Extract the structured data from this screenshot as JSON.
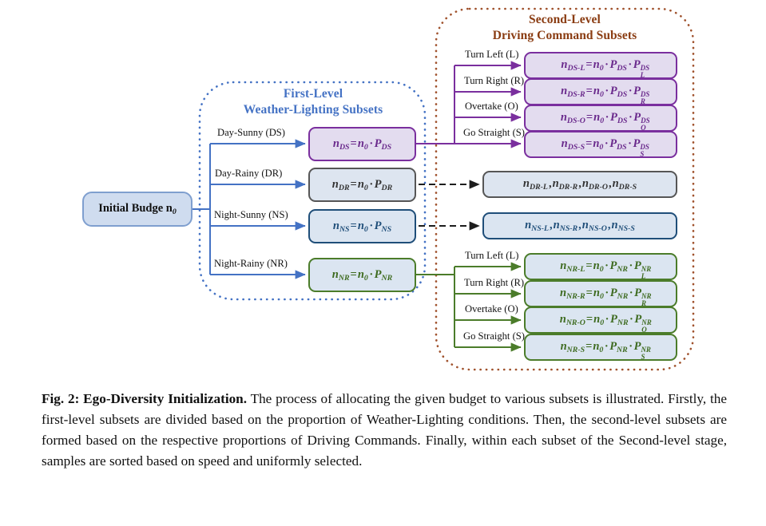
{
  "figure": {
    "groups": {
      "first_level": {
        "title_line1": "First-Level",
        "title_line2": "Weather-Lighting Subsets",
        "color": "#4472c4"
      },
      "second_level": {
        "title_line1": "Second-Level",
        "title_line2": "Driving Command Subsets",
        "color": "#8a3c12"
      }
    },
    "initial": {
      "label": "Initial Budge n",
      "sub": "0"
    },
    "first_level_rows": [
      {
        "edge_label": "Day-Sunny (DS)",
        "n_sub": "DS",
        "p_sub": "DS",
        "color_key": "purple"
      },
      {
        "edge_label": "Day-Rainy (DR)",
        "n_sub": "DR",
        "p_sub": "DR",
        "color_key": "gray"
      },
      {
        "edge_label": "Night-Sunny (NS)",
        "n_sub": "NS",
        "p_sub": "NS",
        "color_key": "blue"
      },
      {
        "edge_label": "Night-Rainy (NR)",
        "n_sub": "NR",
        "p_sub": "NR",
        "color_key": "green"
      }
    ],
    "command_labels": [
      "Turn Left (L)",
      "Turn Right (R)",
      "Overtake (O)",
      "Go Straight (S)"
    ],
    "second_level_ds": [
      {
        "n_sub": "DS-L",
        "p_sub": "DS",
        "p_sup": "DS",
        "p_cmd": "L"
      },
      {
        "n_sub": "DS-R",
        "p_sub": "DS",
        "p_sup": "DS",
        "p_cmd": "R"
      },
      {
        "n_sub": "DS-O",
        "p_sub": "DS",
        "p_sup": "DS",
        "p_cmd": "O"
      },
      {
        "n_sub": "DS-S",
        "p_sub": "DS",
        "p_sup": "DS",
        "p_cmd": "S"
      }
    ],
    "second_level_nr": [
      {
        "n_sub": "NR-L",
        "p_sub": "NR",
        "p_sup": "NR",
        "p_cmd": "L"
      },
      {
        "n_sub": "NR-R",
        "p_sub": "NR",
        "p_sup": "NR",
        "p_cmd": "R"
      },
      {
        "n_sub": "NR-O",
        "p_sub": "NR",
        "p_sup": "NR",
        "p_cmd": "O"
      },
      {
        "n_sub": "NR-S",
        "p_sub": "NR",
        "p_sup": "NR",
        "p_cmd": "S"
      }
    ],
    "collapsed_rows": [
      {
        "items": [
          "DR-L",
          "DR-R",
          "DR-O",
          "DR-S"
        ],
        "color_key": "gray"
      },
      {
        "items": [
          "NS-L",
          "NS-R",
          "NS-O",
          "NS-S"
        ],
        "color_key": "blue"
      }
    ],
    "colors": {
      "purple": "#7a2f9e",
      "gray": "#565656",
      "blue": "#1f4e79",
      "green": "#4b7c2a",
      "arrow_blue": "#4472c4",
      "dotted_blue": "#4472c4",
      "dotted_brown": "#a0522d",
      "box_fill_light_blue": "#dbe5f1",
      "box_fill_purple": "#e3dcef"
    }
  },
  "caption": {
    "label": "Fig. 2:",
    "title": "Ego-Diversity Initialization.",
    "body": "The process of allocating the given budget to various subsets is illustrated. Firstly, the first-level subsets are divided based on the proportion of Weather-Lighting conditions. Then, the second-level subsets are formed based on the respective proportions of Driving Commands. Finally, within each subset of the Second-level stage, samples are sorted based on speed and uniformly selected."
  }
}
